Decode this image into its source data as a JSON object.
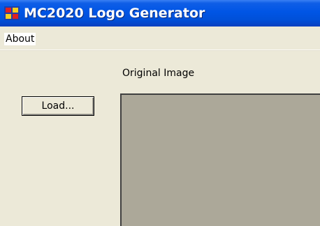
{
  "window": {
    "title": "MC2020 Logo Generator",
    "icon": "app-window-icon"
  },
  "menu": {
    "items": [
      {
        "label": "About"
      }
    ]
  },
  "main": {
    "original_image_label": "Original Image",
    "load_button_label": "Load..."
  },
  "colors": {
    "titlebar": "#0055e5",
    "window_bg": "#ece9d8",
    "image_placeholder": "#aca899"
  }
}
